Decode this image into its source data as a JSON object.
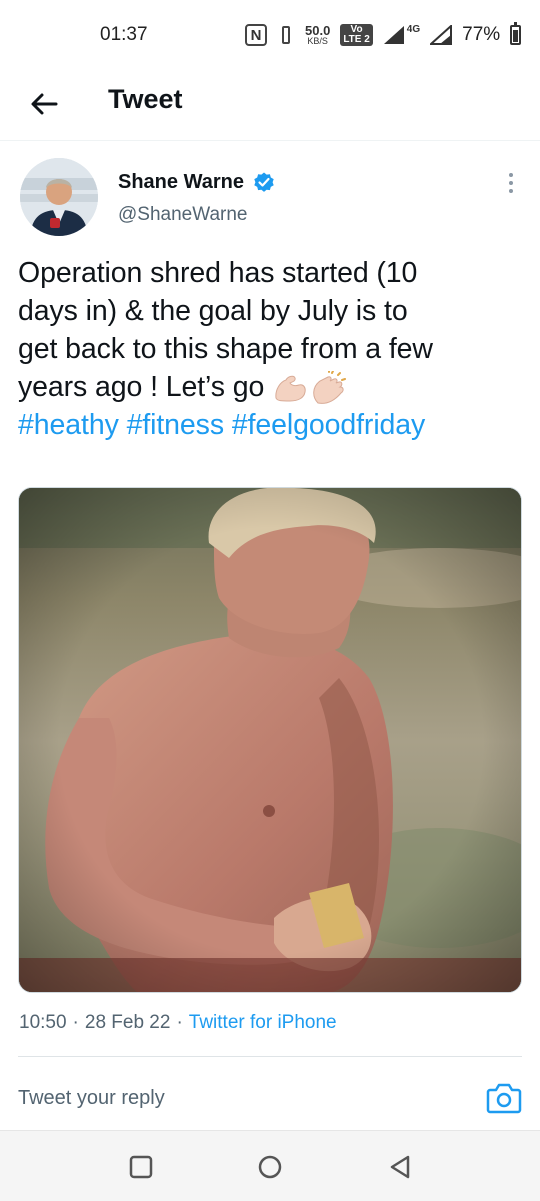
{
  "status_bar": {
    "time": "01:37",
    "nfc": "N",
    "net_speed_value": "50.0",
    "net_speed_unit": "KB/S",
    "volte_top": "Vo",
    "volte_bottom": "LTE 2",
    "network": "4G",
    "battery": "77%"
  },
  "header": {
    "back_icon": "arrow-left-icon",
    "title": "Tweet"
  },
  "tweet": {
    "author_name": "Shane Warne",
    "verified_icon": "verified-badge-icon",
    "handle": "@ShaneWarne",
    "text_lines": [
      "Operation shred has started (10",
      "days in) & the goal by July is to",
      "get back to this shape from a few",
      "years ago ! Let’s go "
    ],
    "emojis": [
      "flexed-biceps-icon",
      "clapping-hands-icon"
    ],
    "hashtags": [
      "#heathy",
      "#fitness",
      "#feelgoodfriday"
    ],
    "time": "10:50",
    "separator": "·",
    "date": "28 Feb 22",
    "source": "Twitter for iPhone"
  },
  "reply": {
    "placeholder": "Tweet your reply",
    "camera_icon": "camera-icon"
  },
  "nav": {
    "recents": "square-icon",
    "home": "circle-icon",
    "back": "triangle-back-icon"
  },
  "colors": {
    "accent": "#1d9bf0",
    "text": "#0f1419",
    "secondary": "#536471"
  }
}
